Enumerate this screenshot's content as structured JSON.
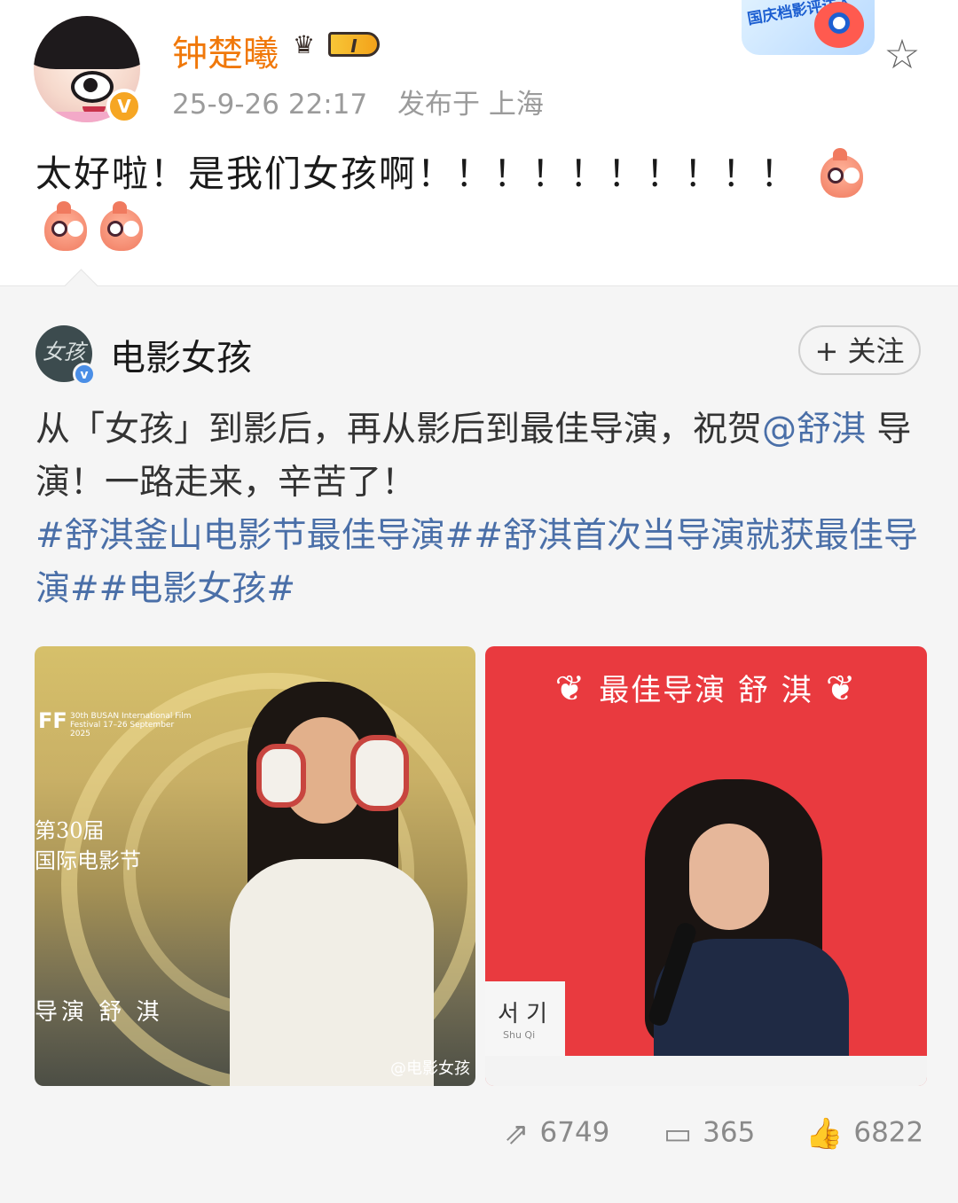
{
  "post": {
    "author": {
      "name": "钟楚曦",
      "level": "I",
      "verified_mark": "V"
    },
    "meta": {
      "time": "25-9-26 22:17",
      "location": "发布于 上海"
    },
    "event_badge": "国庆档影评达人",
    "text": "太好啦！是我们女孩啊！！！！！！！！！！"
  },
  "repost": {
    "author": {
      "name": "电影女孩",
      "avatar_text": "女孩",
      "verified_mark": "v"
    },
    "follow_label": "+ 关注",
    "text": {
      "part1": "从「女孩」到影后，再从影后到最佳导演，祝贺",
      "mention": "@舒淇",
      "part2": " 导演！一路走来，辛苦了！",
      "hashtags": "#舒淇釜山电影节最佳导演##舒淇首次当导演就获最佳导演##电影女孩#"
    },
    "images": {
      "left": {
        "festival_mark": "FF",
        "festival_sub": "30th BUSAN International Film Festival 17–26 September 2025",
        "caption1": "第30届",
        "caption2": "国际电影节",
        "caption3": "导演 舒 淇",
        "watermark": "@电影女孩"
      },
      "right": {
        "award": "最佳导演  舒  淇",
        "name_card_kr": "서 기",
        "name_card_en": "Shu Qi"
      }
    }
  },
  "stats": {
    "shares": "6749",
    "comments": "365",
    "likes": "6822"
  },
  "icons": [
    "star-icon",
    "share-icon",
    "comment-icon",
    "like-icon",
    "crown-icon",
    "verified-icon"
  ]
}
